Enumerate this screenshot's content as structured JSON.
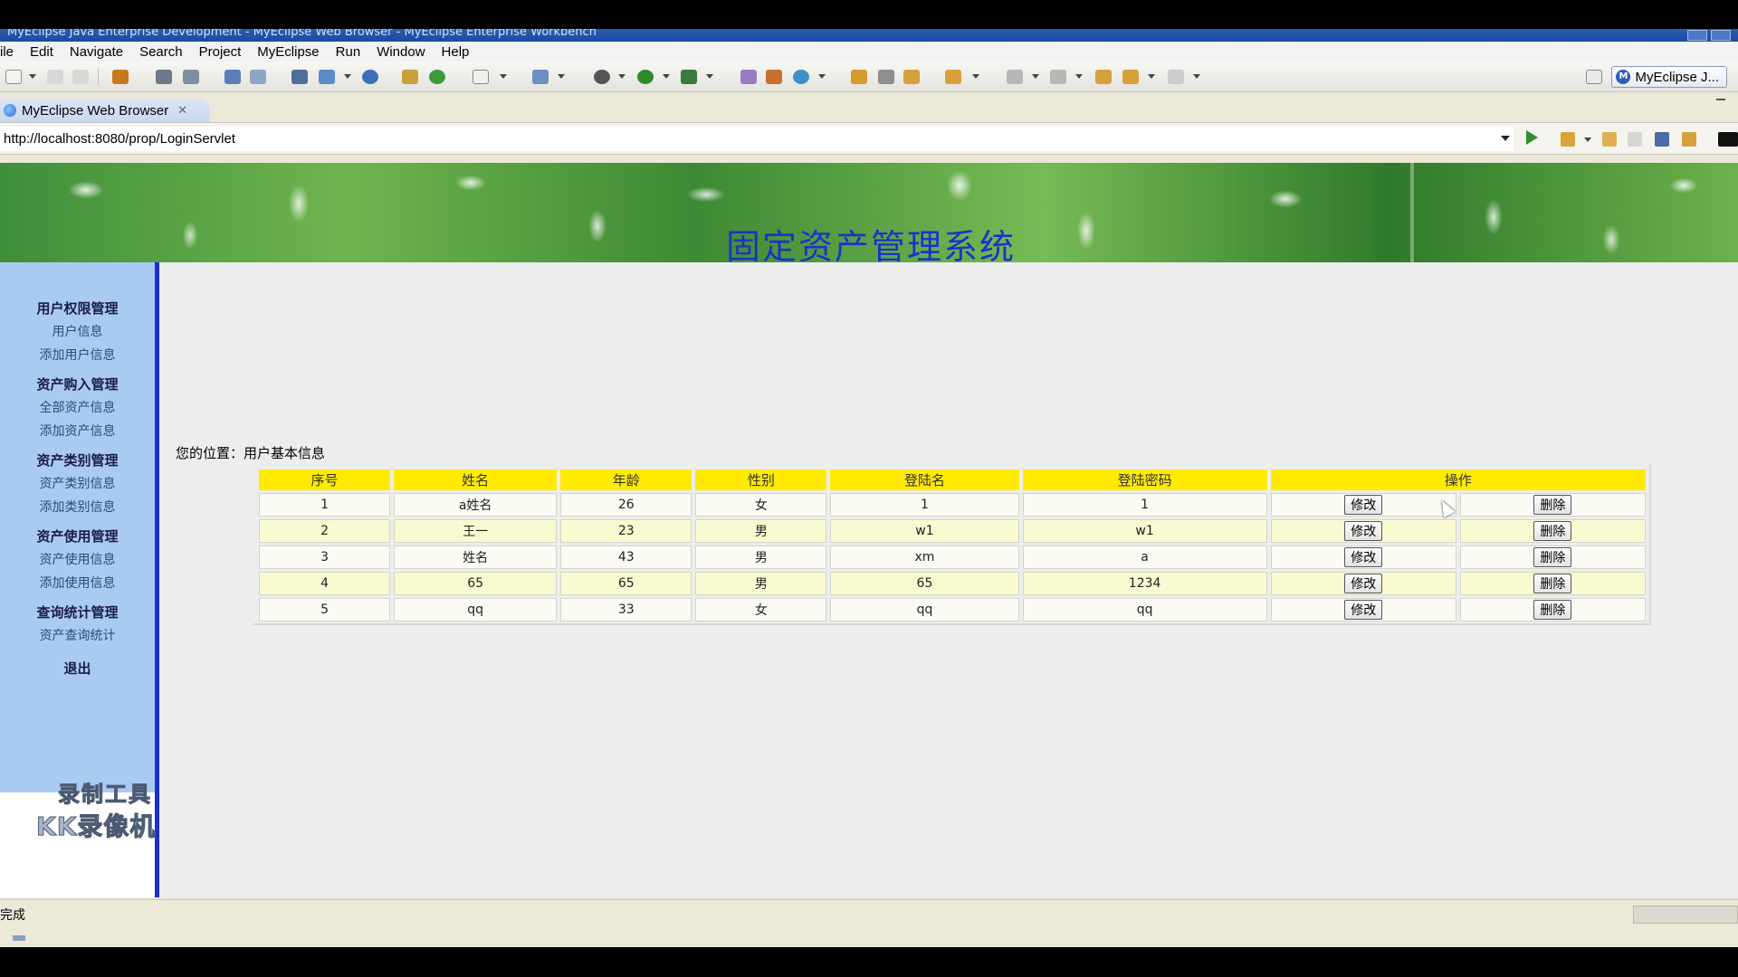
{
  "window": {
    "title": "MyEclipse Java Enterprise Development - MyEclipse Web Browser - MyEclipse Enterprise Workbench"
  },
  "menu": [
    "ile",
    "Edit",
    "Navigate",
    "Search",
    "Project",
    "MyEclipse",
    "Run",
    "Window",
    "Help"
  ],
  "toolbar": {
    "perspective_label": "MyEclipse J..."
  },
  "editor_tab": {
    "label": "MyEclipse Web Browser"
  },
  "address": {
    "url": "http://localhost:8080/prop/LoginServlet"
  },
  "page": {
    "system_title": "固定资产管理系统",
    "location_label": "您的位置：用户基本信息"
  },
  "sidebar": {
    "groups": [
      {
        "title": "用户权限管理",
        "links": [
          "用户信息",
          "添加用户信息"
        ]
      },
      {
        "title": "资产购入管理",
        "links": [
          "全部资产信息",
          "添加资产信息"
        ]
      },
      {
        "title": "资产类别管理",
        "links": [
          "资产类别信息",
          "添加类别信息"
        ]
      },
      {
        "title": "资产使用管理",
        "links": [
          "资产使用信息",
          "添加使用信息"
        ]
      },
      {
        "title": "查询统计管理",
        "links": [
          "资产查询统计"
        ]
      }
    ],
    "logout": "退出",
    "watermark_line1": "录制工具",
    "watermark_line2": "KK录像机"
  },
  "table": {
    "headers": [
      "序号",
      "姓名",
      "年龄",
      "性别",
      "登陆名",
      "登陆密码",
      "操作"
    ],
    "edit_label": "修改",
    "delete_label": "删除",
    "rows": [
      [
        "1",
        "a姓名",
        "26",
        "女",
        "1",
        "1"
      ],
      [
        "2",
        "王一",
        "23",
        "男",
        "w1",
        "w1"
      ],
      [
        "3",
        "姓名",
        "43",
        "男",
        "xm",
        "a"
      ],
      [
        "4",
        "65",
        "65",
        "男",
        "65",
        "1234"
      ],
      [
        "5",
        "qq",
        "33",
        "女",
        "qq",
        "qq"
      ]
    ]
  },
  "status": {
    "text": "完成"
  },
  "colors": {
    "header_yellow": "#ffea00",
    "title_blue": "#1a33c8",
    "sidebar_blue": "#a9cbf3",
    "sidebar_border": "#1a2fd0"
  }
}
